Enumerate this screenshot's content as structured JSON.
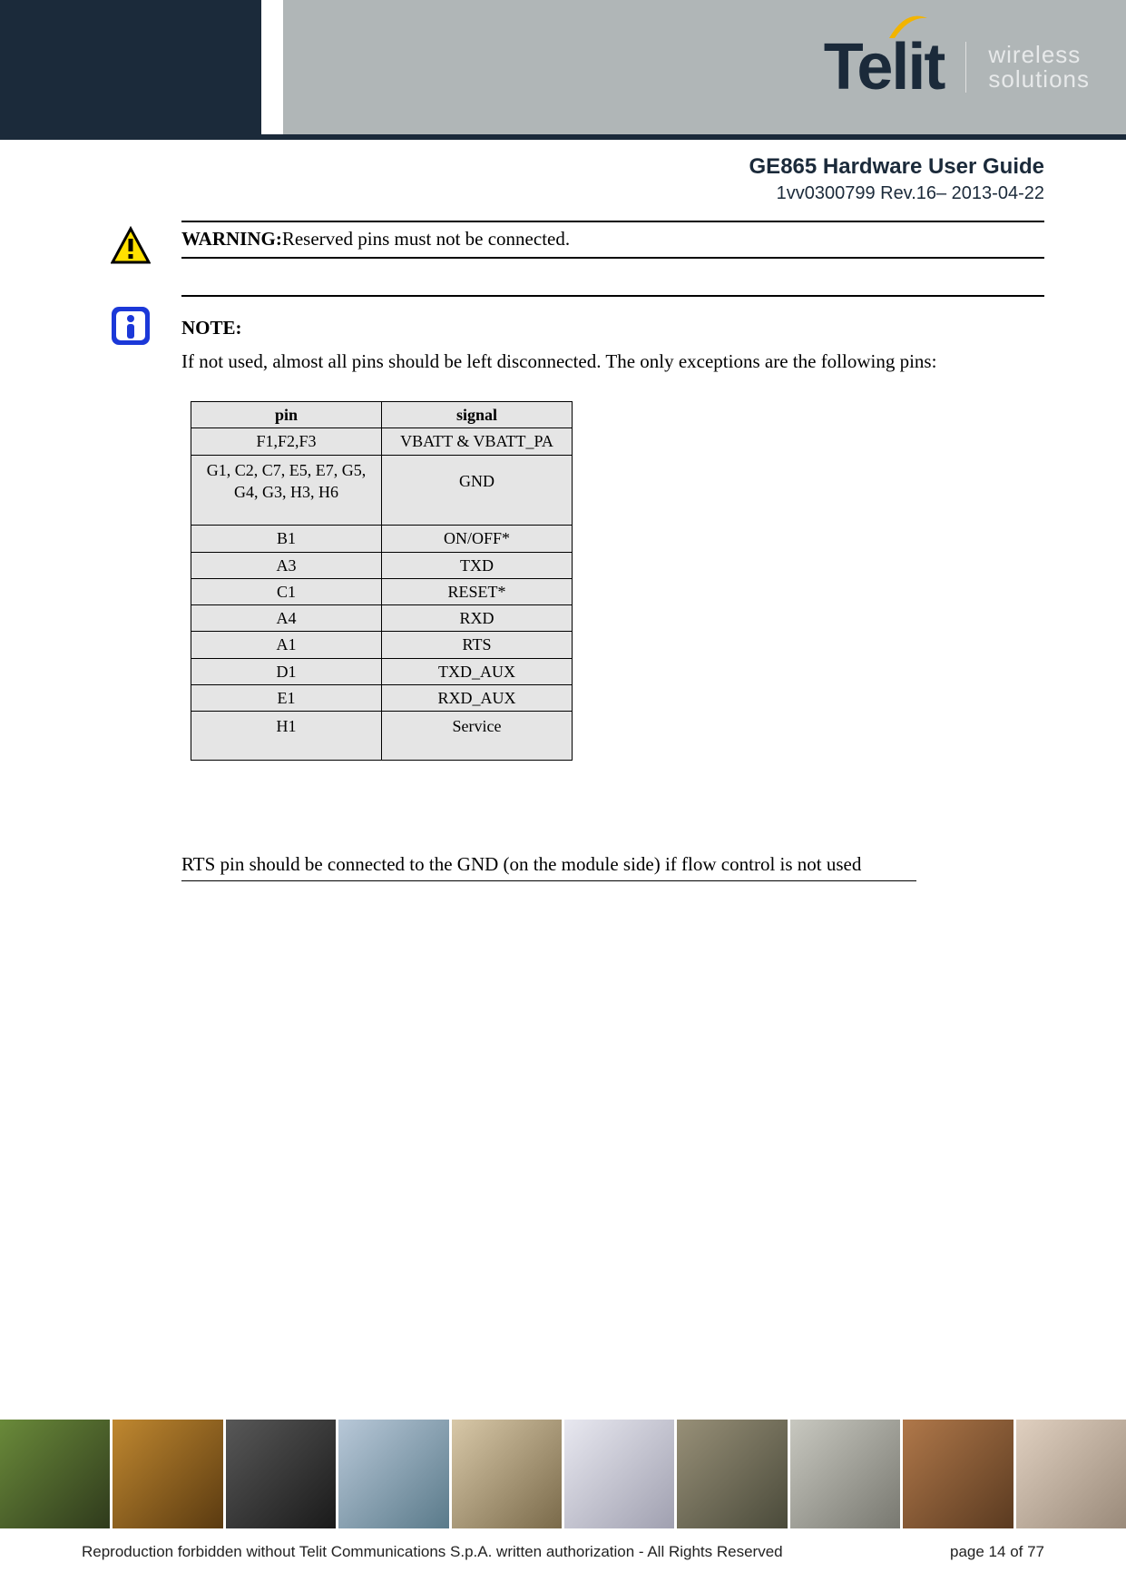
{
  "brand": {
    "name": "Telit",
    "tag1": "wireless",
    "tag2": "solutions"
  },
  "doc": {
    "title": "GE865 Hardware User Guide",
    "rev": "1vv0300799 Rev.16– 2013-04-22"
  },
  "warning": {
    "label": "WARNING:",
    "text": "Reserved pins must not be connected."
  },
  "note": {
    "label": "NOTE:",
    "text": "If not used, almost all pins should be left disconnected. The only exceptions are the following pins:"
  },
  "table": {
    "headers": {
      "pin": "pin",
      "signal": "signal"
    },
    "rows": [
      {
        "pin": "F1,F2,F3",
        "signal": "VBATT & VBATT_PA"
      },
      {
        "pin": "G1, C2, C7, E5, E7, G5, G4, G3, H3, H6",
        "signal": "GND"
      },
      {
        "pin": "B1",
        "signal": "ON/OFF*"
      },
      {
        "pin": "A3",
        "signal": "TXD"
      },
      {
        "pin": "C1",
        "signal": "RESET*"
      },
      {
        "pin": "A4",
        "signal": "RXD"
      },
      {
        "pin": "A1",
        "signal": "RTS"
      },
      {
        "pin": "D1",
        "signal": "TXD_AUX"
      },
      {
        "pin": "E1",
        "signal": "RXD_AUX"
      },
      {
        "pin": "H1",
        "signal": "Service"
      }
    ]
  },
  "rts_note": "RTS pin should be connected to the GND (on the module side) if flow control is not used",
  "footer": {
    "copyright": "Reproduction forbidden without Telit Communications S.p.A. written authorization - All Rights Reserved",
    "page": "page 14 of 77"
  }
}
